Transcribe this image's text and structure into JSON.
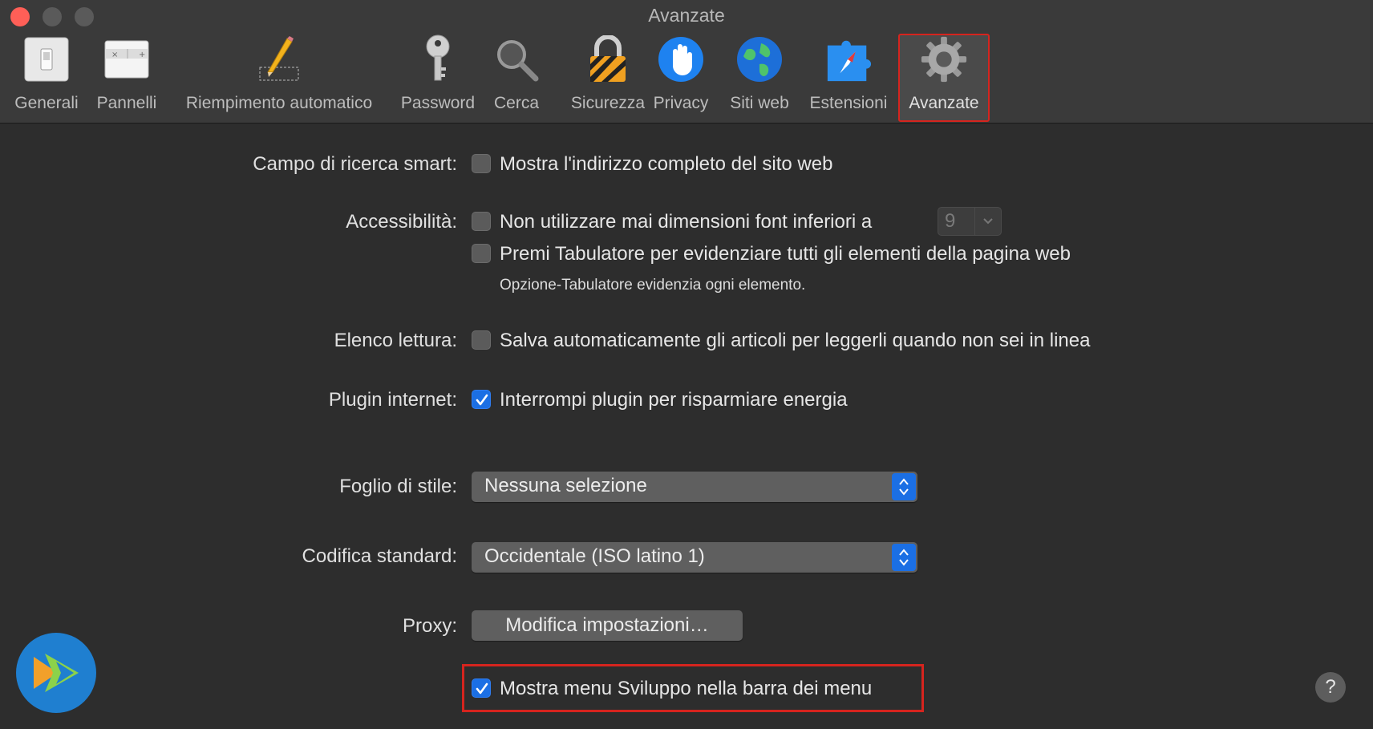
{
  "window": {
    "title": "Avanzate",
    "toolbar": [
      {
        "label": "Generali",
        "icon": "general-switch-icon"
      },
      {
        "label": "Pannelli",
        "icon": "tabs-icon"
      },
      {
        "label": "Riempimento automatico",
        "icon": "pencil-autofill-icon"
      },
      {
        "label": "Password",
        "icon": "key-icon"
      },
      {
        "label": "Cerca",
        "icon": "magnifier-icon"
      },
      {
        "label": "Sicurezza",
        "icon": "padlock-icon"
      },
      {
        "label": "Privacy",
        "icon": "hand-icon"
      },
      {
        "label": "Siti web",
        "icon": "globe-icon"
      },
      {
        "label": "Estensioni",
        "icon": "puzzle-compass-icon"
      },
      {
        "label": "Avanzate",
        "icon": "gear-icon",
        "selected": true
      }
    ]
  },
  "settings": {
    "smart_search": {
      "label": "Campo di ricerca smart:",
      "option": "Mostra l'indirizzo completo del sito web",
      "checked": false
    },
    "accessibility": {
      "label": "Accessibilità:",
      "option1": "Non utilizzare mai dimensioni font inferiori a",
      "option1_checked": false,
      "font_size_value": "9",
      "option2": "Premi Tabulatore per evidenziare tutti gli elementi della pagina web",
      "option2_checked": false,
      "hint": "Opzione-Tabulatore evidenzia ogni elemento."
    },
    "reading_list": {
      "label": "Elenco lettura:",
      "option": "Salva automaticamente gli articoli per leggerli quando non sei in linea",
      "checked": false
    },
    "internet_plugins": {
      "label": "Plugin internet:",
      "option": "Interrompi plugin per risparmiare energia",
      "checked": true
    },
    "stylesheet": {
      "label": "Foglio di stile:",
      "value": "Nessuna selezione"
    },
    "encoding": {
      "label": "Codifica standard:",
      "value": "Occidentale (ISO latino 1)"
    },
    "proxy": {
      "label": "Proxy:",
      "button": "Modifica impostazioni…"
    },
    "develop_menu": {
      "option": "Mostra menu Sviluppo nella barra dei menu",
      "checked": true
    }
  },
  "help_label": "?",
  "colors": {
    "accent": "#1b6fe4",
    "highlight": "#d6241e",
    "background": "#2d2d2d"
  }
}
